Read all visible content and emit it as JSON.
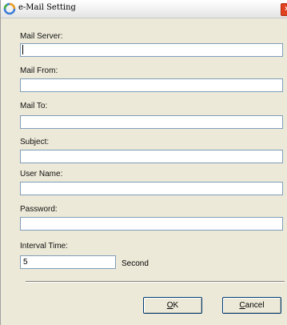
{
  "window": {
    "title": "e-Mail Setting",
    "close_glyph": "×"
  },
  "fields": {
    "mail_server": {
      "label": "Mail Server:",
      "value": ""
    },
    "mail_from": {
      "label": "Mail From:",
      "value": ""
    },
    "mail_to": {
      "label": "Mail To:",
      "value": ""
    },
    "subject": {
      "label": "Subject:",
      "value": ""
    },
    "user_name": {
      "label": "User Name:",
      "value": ""
    },
    "password": {
      "label": "Password:",
      "value": ""
    },
    "interval": {
      "label": "Interval Time:",
      "value": "5",
      "unit": "Second"
    }
  },
  "buttons": {
    "ok": {
      "mnemonic": "O",
      "rest": "K"
    },
    "cancel": {
      "mnemonic": "C",
      "rest": "ancel"
    }
  },
  "colors": {
    "close_button": "#e0411f",
    "input_border": "#7f9db9",
    "window_bg": "#ece9d8"
  },
  "icons": {
    "app": "circular-arrow-icon",
    "close": "close-icon"
  }
}
